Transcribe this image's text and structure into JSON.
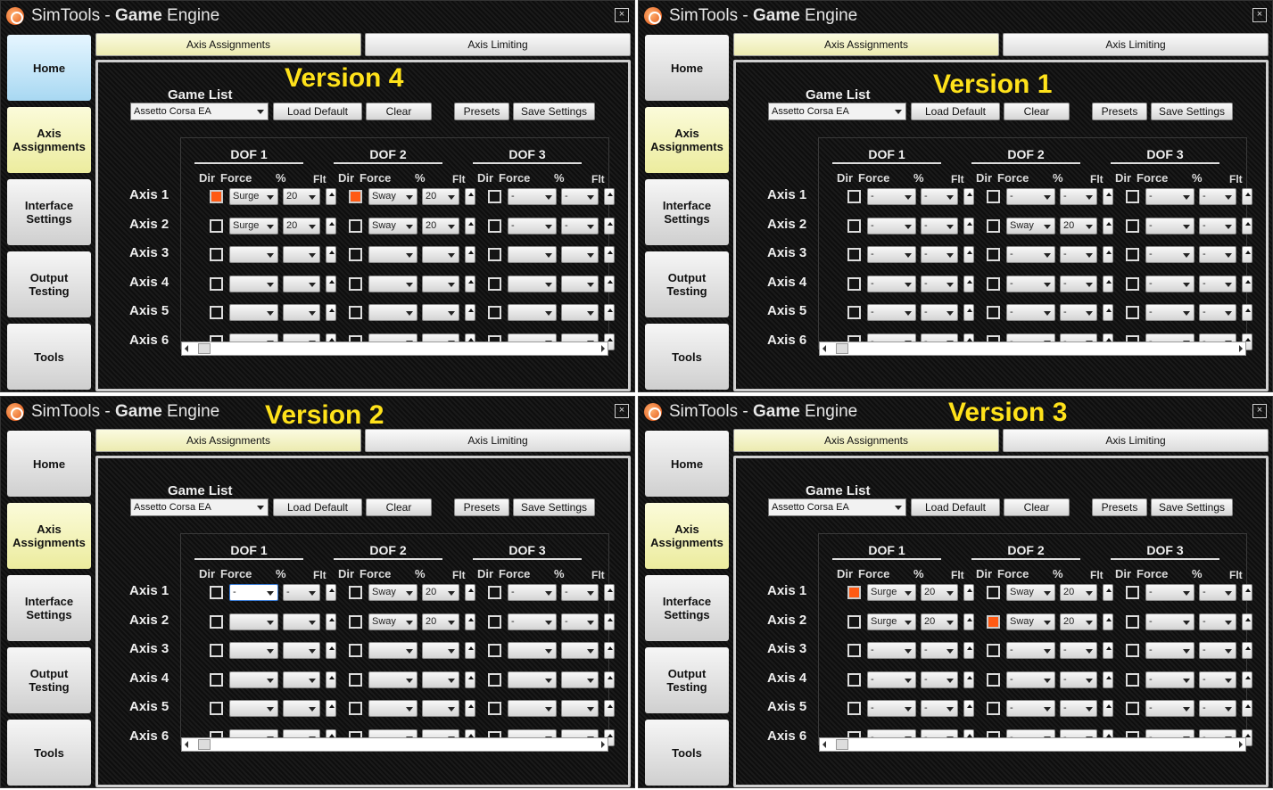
{
  "common": {
    "title_prefix": "SimTools",
    "title_sep": " - ",
    "title_strong": "Game",
    "title_suffix": " Engine",
    "close_glyph": "×",
    "nav": [
      "Home",
      "Axis\nAssignments",
      "Interface\nSettings",
      "Output\nTesting",
      "Tools"
    ],
    "tabs": [
      "Axis Assignments",
      "Axis Limiting"
    ],
    "game_list_label": "Game List",
    "game_value": "Assetto Corsa EA",
    "buttons": [
      "Load Default",
      "Clear",
      "Presets",
      "Save Settings"
    ],
    "dof_titles": [
      "DOF 1",
      "DOF 2",
      "DOF 3"
    ],
    "col_headers": [
      "Dir",
      "Force",
      "%",
      "Flt"
    ],
    "axis_labels": [
      "Axis 1",
      "Axis 2",
      "Axis 3",
      "Axis 4",
      "Axis 5",
      "Axis 6"
    ],
    "empty": "-"
  },
  "windows": [
    {
      "version": "Version 4",
      "home_active": true,
      "cells": [
        [
          [
            true,
            "Surge",
            "20"
          ],
          [
            true,
            "Sway",
            "20"
          ],
          [
            false,
            "-",
            "-"
          ]
        ],
        [
          [
            false,
            "Surge",
            "20"
          ],
          [
            false,
            "Sway",
            "20"
          ],
          [
            false,
            "-",
            "-"
          ]
        ],
        [
          [
            false,
            "",
            ""
          ],
          [
            false,
            "",
            ""
          ],
          [
            false,
            "",
            ""
          ]
        ],
        [
          [
            false,
            "",
            ""
          ],
          [
            false,
            "",
            ""
          ],
          [
            false,
            "",
            ""
          ]
        ],
        [
          [
            false,
            "",
            ""
          ],
          [
            false,
            "",
            ""
          ],
          [
            false,
            "",
            ""
          ]
        ],
        [
          [
            false,
            "",
            ""
          ],
          [
            false,
            "",
            ""
          ],
          [
            false,
            "",
            ""
          ]
        ]
      ]
    },
    {
      "version": "Version 1",
      "home_active": false,
      "cells": [
        [
          [
            false,
            "-",
            "-"
          ],
          [
            false,
            "-",
            "-"
          ],
          [
            false,
            "-",
            "-"
          ]
        ],
        [
          [
            false,
            "-",
            "-"
          ],
          [
            false,
            "Sway",
            "20"
          ],
          [
            false,
            "-",
            "-"
          ]
        ],
        [
          [
            false,
            "-",
            "-"
          ],
          [
            false,
            "-",
            "-"
          ],
          [
            false,
            "-",
            "-"
          ]
        ],
        [
          [
            false,
            "-",
            "-"
          ],
          [
            false,
            "-",
            "-"
          ],
          [
            false,
            "-",
            "-"
          ]
        ],
        [
          [
            false,
            "-",
            "-"
          ],
          [
            false,
            "-",
            "-"
          ],
          [
            false,
            "-",
            "-"
          ]
        ],
        [
          [
            false,
            "-",
            "-"
          ],
          [
            false,
            "-",
            "-"
          ],
          [
            false,
            "-",
            "-"
          ]
        ]
      ]
    },
    {
      "version": "Version 2",
      "home_active": false,
      "cells": [
        [
          [
            false,
            "-",
            "-"
          ],
          [
            false,
            "Sway",
            "20"
          ],
          [
            false,
            "-",
            "-"
          ]
        ],
        [
          [
            false,
            "",
            ""
          ],
          [
            false,
            "Sway",
            "20"
          ],
          [
            false,
            "-",
            "-"
          ]
        ],
        [
          [
            false,
            "",
            ""
          ],
          [
            false,
            "",
            ""
          ],
          [
            false,
            "",
            ""
          ]
        ],
        [
          [
            false,
            "",
            ""
          ],
          [
            false,
            "",
            ""
          ],
          [
            false,
            "",
            ""
          ]
        ],
        [
          [
            false,
            "",
            ""
          ],
          [
            false,
            "",
            ""
          ],
          [
            false,
            "",
            ""
          ]
        ],
        [
          [
            false,
            "",
            ""
          ],
          [
            false,
            "",
            ""
          ],
          [
            false,
            "",
            ""
          ]
        ]
      ]
    },
    {
      "version": "Version 3",
      "home_active": false,
      "cells": [
        [
          [
            true,
            "Surge",
            "20"
          ],
          [
            false,
            "Sway",
            "20"
          ],
          [
            false,
            "-",
            "-"
          ]
        ],
        [
          [
            false,
            "Surge",
            "20"
          ],
          [
            true,
            "Sway",
            "20"
          ],
          [
            false,
            "-",
            "-"
          ]
        ],
        [
          [
            false,
            "-",
            "-"
          ],
          [
            false,
            "-",
            "-"
          ],
          [
            false,
            "-",
            "-"
          ]
        ],
        [
          [
            false,
            "-",
            "-"
          ],
          [
            false,
            "-",
            "-"
          ],
          [
            false,
            "-",
            "-"
          ]
        ],
        [
          [
            false,
            "-",
            "-"
          ],
          [
            false,
            "-",
            "-"
          ],
          [
            false,
            "-",
            "-"
          ]
        ],
        [
          [
            false,
            "-",
            "-"
          ],
          [
            false,
            "-",
            "-"
          ],
          [
            false,
            "-",
            "-"
          ]
        ]
      ]
    }
  ]
}
